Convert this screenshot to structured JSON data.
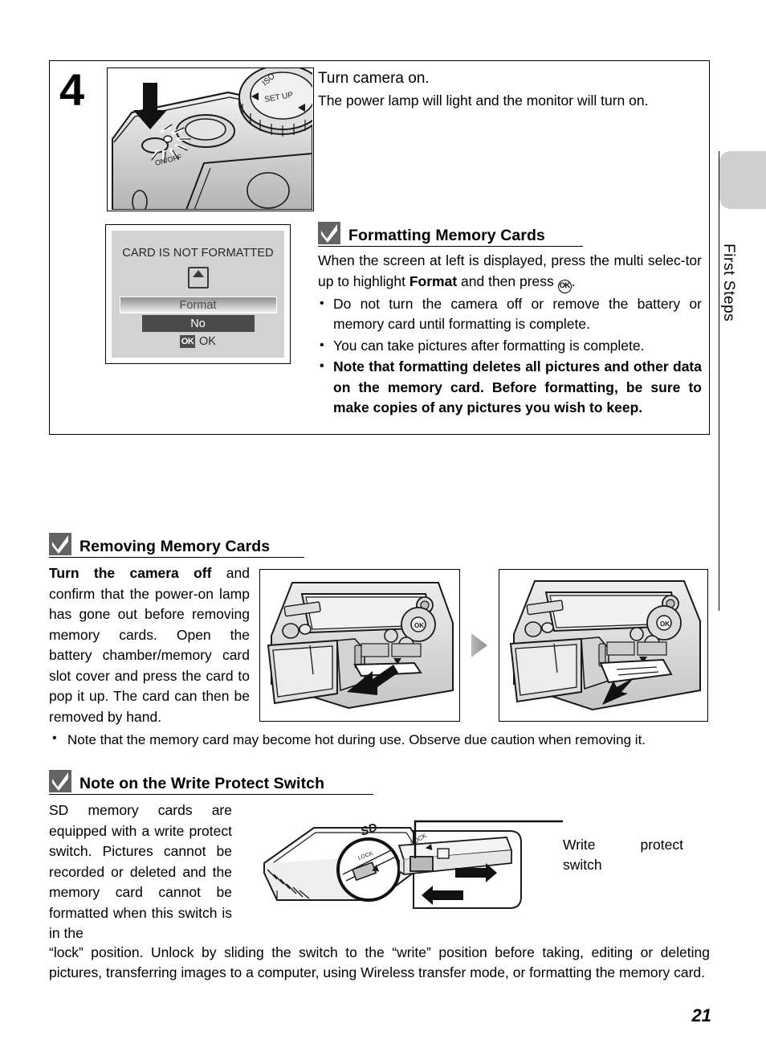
{
  "page": {
    "number": "21",
    "edge_tab_label": "First Steps"
  },
  "step": {
    "number": "4",
    "lead": "Turn camera on.",
    "body": "The power lamp will light and the monitor will turn on."
  },
  "lcd": {
    "message": "CARD IS NOT FORMATTED",
    "option_format": "Format",
    "option_no": "No",
    "ok_glyph": "OK",
    "ok_label": "OK"
  },
  "formatting_note": {
    "icon": "checkmark-icon",
    "title": "Formatting Memory Cards",
    "intro_a": "When the screen at left is displayed, press the multi selec-tor up to highlight ",
    "intro_bold": "Format",
    "intro_b": " and then press ",
    "ok_glyph": "OK",
    "intro_c": ".",
    "bullets": [
      "Do not turn the camera off or remove the battery or memory card until formatting is complete.",
      "You can take pictures after formatting is complete."
    ],
    "bullet_bold": "Note that formatting deletes all pictures and other data on the memory card. Before formatting, be sure to make copies of any pictures you wish to keep."
  },
  "removing_note": {
    "icon": "checkmark-icon",
    "title": "Removing Memory Cards",
    "body_bold": "Turn the camera off",
    "body_rest": " and confirm that the power-on lamp has gone out before removing memory cards. Open the battery chamber/memory card slot cover and press the card to pop it up. The card can then be removed by hand.",
    "footnote": "Note that the memory card may become hot during use. Observe due caution when removing it."
  },
  "write_protect_note": {
    "icon": "checkmark-icon",
    "title": "Note on the Write Protect Switch",
    "body": "SD memory cards are equipped with a write protect switch. Pictures cannot be recorded or deleted and the memory card cannot be formatted when this switch is in the",
    "tail": "“lock” position. Unlock by sliding the switch to the “write” position before taking, editing or deleting pictures, transferring images to a computer, using Wireless transfer mode, or formatting the memory card.",
    "callout_label": "Write protect switch",
    "card_lock_text": "LOCK"
  },
  "colors": {
    "badge_gray": "#636363",
    "lcd_background": "#d2d2d2",
    "selected_row": "#4a4a4a",
    "tab_gray": "#cfcfcf"
  }
}
